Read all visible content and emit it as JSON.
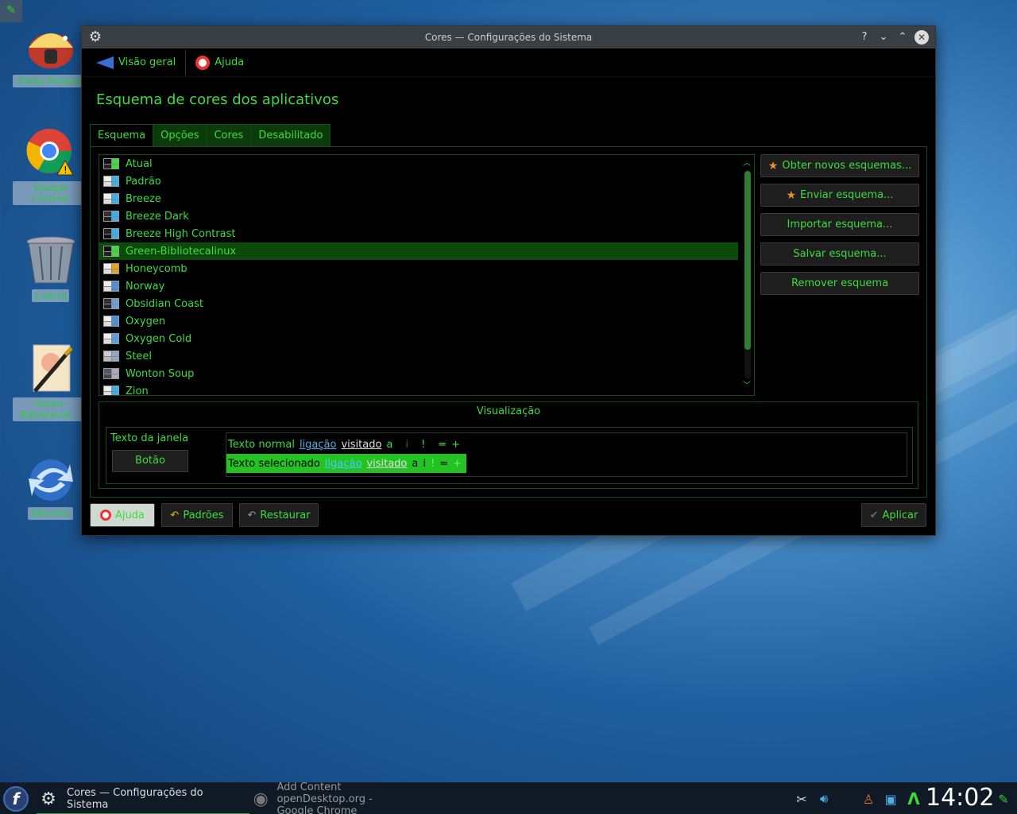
{
  "window": {
    "title": "Cores  — Configurações do Sistema",
    "controls": {
      "help": "?",
      "minimize": "⌄",
      "maximize": "⌃",
      "close": "✕"
    }
  },
  "toolbar": {
    "overview_label": "Visão geral",
    "help_label": "Ajuda"
  },
  "page_title": "Esquema de cores dos aplicativos",
  "tabs": [
    {
      "label": "Esquema",
      "active": true
    },
    {
      "label": "Opções",
      "active": false
    },
    {
      "label": "Cores",
      "active": false
    },
    {
      "label": "Desabilitado",
      "active": false
    }
  ],
  "schemes": [
    {
      "label": "Atual",
      "colors": [
        "#111",
        "#3ddc3d",
        "#222",
        "#3ddc3d"
      ]
    },
    {
      "label": "Padrão",
      "colors": [
        "#eee",
        "#3daee9",
        "#ddd",
        "#3daee9"
      ]
    },
    {
      "label": "Breeze",
      "colors": [
        "#eee",
        "#3daee9",
        "#ddd",
        "#3daee9"
      ]
    },
    {
      "label": "Breeze Dark",
      "colors": [
        "#333",
        "#3daee9",
        "#222",
        "#3daee9"
      ]
    },
    {
      "label": "Breeze High Contrast",
      "colors": [
        "#222",
        "#3daee9",
        "#111",
        "#3daee9"
      ]
    },
    {
      "label": "Green-Bibliotecalinux",
      "colors": [
        "#111",
        "#3ddc3d",
        "#222",
        "#3ddc3d"
      ],
      "selected": true
    },
    {
      "label": "Honeycomb",
      "colors": [
        "#eee",
        "#f0a020",
        "#ddd",
        "#f0a020"
      ]
    },
    {
      "label": "Norway",
      "colors": [
        "#eee",
        "#4a8fd9",
        "#ddd",
        "#4a8fd9"
      ]
    },
    {
      "label": "Obsidian Coast",
      "colors": [
        "#333",
        "#6a9fd9",
        "#222",
        "#6a9fd9"
      ]
    },
    {
      "label": "Oxygen",
      "colors": [
        "#eee",
        "#4a8fd9",
        "#ddd",
        "#4a8fd9"
      ]
    },
    {
      "label": "Oxygen Cold",
      "colors": [
        "#eee",
        "#5aa0e0",
        "#ddd",
        "#5aa0e0"
      ]
    },
    {
      "label": "Steel",
      "colors": [
        "#ccc",
        "#8fa8c8",
        "#bbb",
        "#8fa8c8"
      ]
    },
    {
      "label": "Wonton Soup",
      "colors": [
        "#556",
        "#aab",
        "#445",
        "#aab"
      ]
    },
    {
      "label": "Zion",
      "colors": [
        "#eee",
        "#3daee9",
        "#ddd",
        "#3daee9"
      ]
    }
  ],
  "side_buttons": {
    "get_new": "Obter novos esquemas...",
    "send": "Enviar esquema...",
    "import": "Importar esquema...",
    "save": "Salvar esquema...",
    "remove": "Remover esquema"
  },
  "preview": {
    "title": "Visualização",
    "window_text": "Texto da janela",
    "button_label": "Botão",
    "normal_text": "Texto normal",
    "selected_text": "Texto selecionado",
    "link": "ligação",
    "visited": "visitado",
    "letter_a": "a",
    "letter_i": "i",
    "excl": "!",
    "equals": "=",
    "plus": "+"
  },
  "bottom_buttons": {
    "help": "Ajuda",
    "defaults": "Padrões",
    "reset": "Restaurar",
    "apply": "Aplicar"
  },
  "desktop_icons": [
    {
      "label": "Pasta Pessoal",
      "icon": "home-folder-icon"
    },
    {
      "label": "Google Chrome",
      "icon": "chrome-icon"
    },
    {
      "label": "Lixeira",
      "icon": "trash-icon"
    },
    {
      "label": "Green-Bibliotecali...",
      "icon": "pen-document-icon"
    },
    {
      "label": "KTorrent",
      "icon": "ktorrent-icon"
    }
  ],
  "taskbar": {
    "launcher": "f",
    "task1_line1": "Cores  — Configurações do",
    "task1_line2": "Sistema",
    "task2_line1": "Add  Content openDesktop.org -",
    "task2_line2": "Google Chrome",
    "clock": "14:02"
  },
  "colors": {
    "accent": "#3ddc3d",
    "selection": "#0b4a0b",
    "window_bg": "#000000",
    "titlebar": "#3a3f44"
  }
}
